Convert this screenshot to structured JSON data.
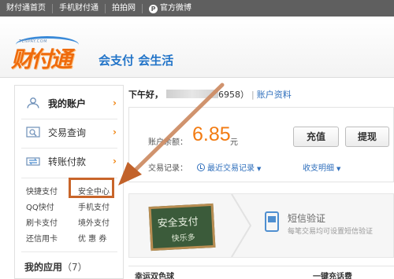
{
  "topbar": {
    "links": [
      "财付通首页",
      "手机财付通",
      "拍拍网",
      "官方微博"
    ]
  },
  "header": {
    "logo_sub": "TENPAY.COM",
    "logo_text": "财付通",
    "slogan": "会支付 会生活"
  },
  "sidebar": {
    "items": [
      {
        "label": "我的账户",
        "icon": "user-icon"
      },
      {
        "label": "交易查询",
        "icon": "search-icon"
      },
      {
        "label": "转账付款",
        "icon": "transfer-icon"
      }
    ],
    "arrow": "›",
    "quick_links": [
      [
        "快捷支付",
        "安全中心"
      ],
      [
        "QQ快付",
        "手机支付"
      ],
      [
        "刷卡支付",
        "境外支付"
      ],
      [
        "还信用卡",
        "优 惠 券"
      ]
    ],
    "apps_title": "我的应用",
    "apps_count": "（7）"
  },
  "greeting": {
    "text": "下午好，",
    "suffix": "6958）",
    "profile_link": "账户资料"
  },
  "account": {
    "balance_label": "账户余额：",
    "balance": "6.85",
    "unit": "元",
    "recharge": "充值",
    "withdraw": "提现",
    "tx_label": "交易记录：",
    "recent_tx": "最近交易记录",
    "detail": "收支明细"
  },
  "promo": {
    "board_line1": "安全支付",
    "board_line2": "快乐多",
    "sms_title": "短信验证",
    "sms_desc": "每笔交易均可设置短信验证"
  },
  "bottom": {
    "left": "幸运双色球",
    "right": "一键充话费"
  },
  "colors": {
    "accent": "#f27b12",
    "link": "#2f6fbc",
    "annotation": "#c8652a"
  }
}
